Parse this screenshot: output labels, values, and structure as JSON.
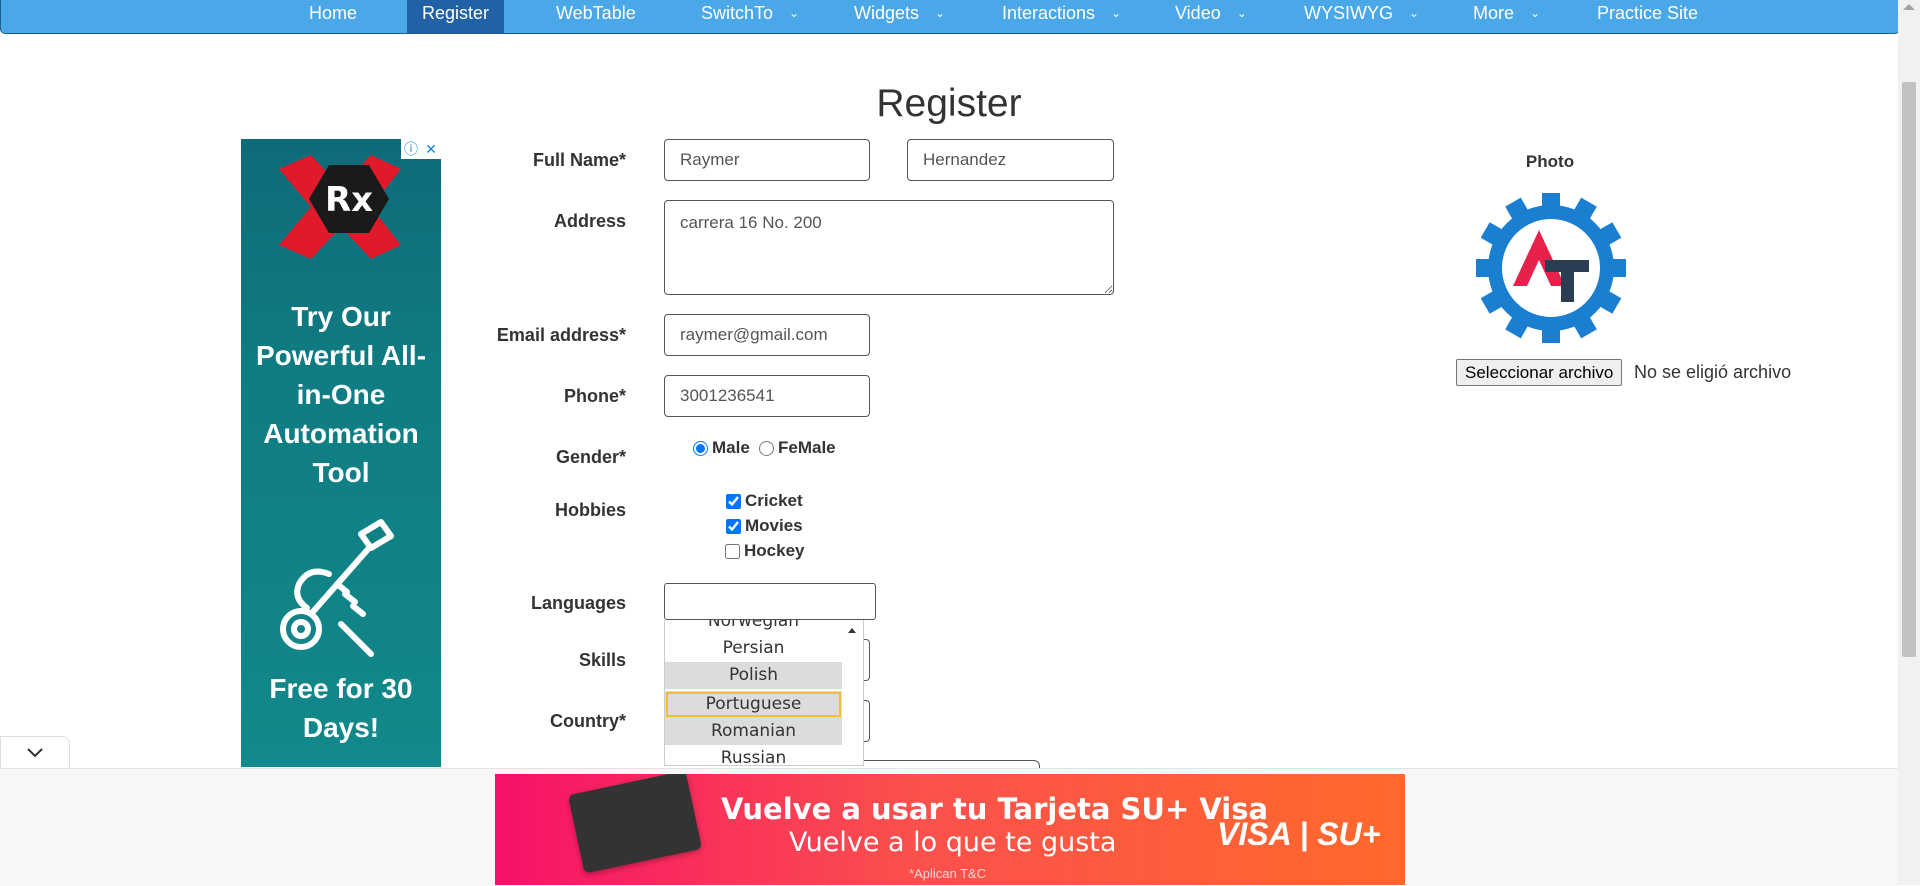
{
  "nav": {
    "items": [
      {
        "label": "Home"
      },
      {
        "label": "Register"
      },
      {
        "label": "WebTable"
      },
      {
        "label": "SwitchTo",
        "caret": "⌄"
      },
      {
        "label": "Widgets",
        "caret": "⌄"
      },
      {
        "label": "Interactions",
        "caret": "⌄"
      },
      {
        "label": "Video",
        "caret": "⌄"
      },
      {
        "label": "WYSIWYG",
        "caret": "⌄"
      },
      {
        "label": "More",
        "caret": "⌄"
      },
      {
        "label": "Practice Site"
      }
    ],
    "active": "Register",
    "bg_color": "#4aa8e8",
    "active_color": "#2161a6"
  },
  "page": {
    "title": "Register"
  },
  "side_ad": {
    "logo_text": "Rx",
    "headline": "Try Our Powerful All-in-One Automation Tool",
    "subline": "Free for 30 Days!",
    "info_icon": "ⓘ",
    "close_icon": "✕"
  },
  "form": {
    "full_name_label": "Full Name*",
    "first_name": "Raymer",
    "last_name": "Hernandez",
    "address_label": "Address",
    "address": "carrera 16 No. 200",
    "email_label": "Email address*",
    "email": "raymer@gmail.com",
    "phone_label": "Phone*",
    "phone": "3001236541",
    "gender_label": "Gender*",
    "gender_options": [
      {
        "label": "Male",
        "checked": true
      },
      {
        "label": "FeMale",
        "checked": false
      }
    ],
    "hobbies_label": "Hobbies",
    "hobbies": [
      {
        "label": "Cricket",
        "checked": true
      },
      {
        "label": "Movies",
        "checked": true
      },
      {
        "label": "Hockey",
        "checked": false
      }
    ],
    "languages_label": "Languages",
    "languages_value": "",
    "language_list": [
      "Norwegian",
      "Persian",
      "Polish",
      "Portuguese",
      "Romanian",
      "Russian"
    ],
    "language_highlighted": "Portuguese",
    "skills_label": "Skills",
    "country_label": "Country*"
  },
  "photo": {
    "label": "Photo",
    "file_button": "Seleccionar archivo",
    "file_status": "No se eligió archivo"
  },
  "bottom_ad": {
    "line1": "Vuelve a usar tu Tarjeta SU+ Visa",
    "line2": "Vuelve a lo que te gusta",
    "small": "*Aplican T&C",
    "brand": "VISA | SU+"
  },
  "collapse_icon": "chevron-down"
}
